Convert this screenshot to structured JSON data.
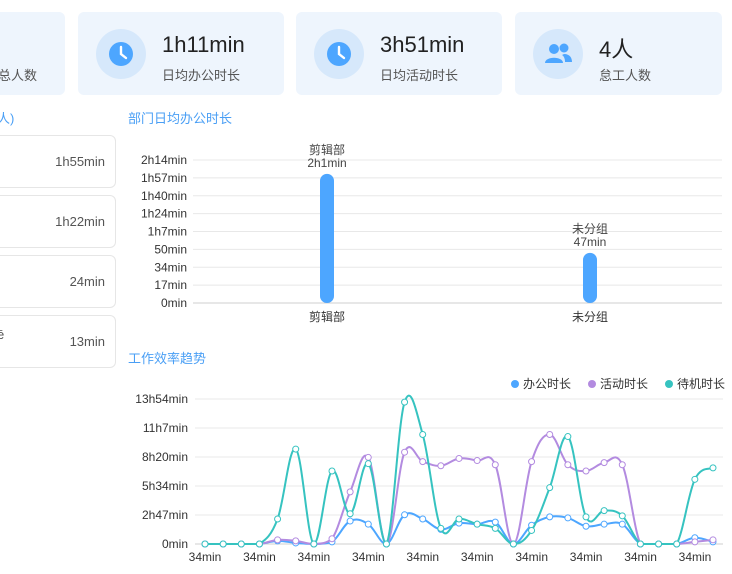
{
  "stats": [
    {
      "value": "",
      "label": "总人数",
      "icon": "people-icon"
    },
    {
      "value": "1h11min",
      "label": "日均办公时长",
      "icon": "clock-icon"
    },
    {
      "value": "3h51min",
      "label": "日均活动时长",
      "icon": "clock-icon"
    },
    {
      "value": "4人",
      "label": "怠工人数",
      "icon": "people-icon"
    }
  ],
  "ranking": {
    "title_fragment": "人)",
    "items": [
      {
        "name": "",
        "value": "1h55min"
      },
      {
        "name": "",
        "value": "1h22min"
      },
      {
        "name": "",
        "value": "24min"
      },
      {
        "name": "ē",
        "value": "13min"
      }
    ]
  },
  "dept_chart": {
    "title": "部门日均办公时长",
    "chart_data": {
      "type": "bar",
      "categories": [
        "剪辑部",
        "未分组"
      ],
      "values": [
        121,
        47
      ],
      "data_labels_name": [
        "剪辑部",
        "未分组"
      ],
      "data_labels_value": [
        "2h1min",
        "47min"
      ],
      "yticks": [
        "0min",
        "17min",
        "34min",
        "50min",
        "1h7min",
        "1h24min",
        "1h40min",
        "1h57min",
        "2h14min"
      ],
      "ylim": [
        0,
        134
      ],
      "color": "#4da6ff"
    }
  },
  "trend_chart": {
    "title": "工作效率趋势",
    "chart_data": {
      "type": "line",
      "series": [
        {
          "name": "办公时长",
          "color": "#4da6ff",
          "values": [
            0,
            0,
            0,
            0,
            0.3,
            0.1,
            0,
            0.2,
            2.2,
            1.9,
            0,
            2.8,
            2.4,
            1.4,
            2.0,
            1.9,
            2.1,
            0,
            1.8,
            2.6,
            2.5,
            1.7,
            1.9,
            1.9,
            0,
            0,
            0,
            0.6,
            0.2
          ]
        },
        {
          "name": "活动时长",
          "color": "#b38be0",
          "values": [
            0,
            0,
            0,
            0,
            0.4,
            0.3,
            0,
            0.5,
            5.0,
            8.3,
            0,
            8.8,
            7.9,
            7.5,
            8.2,
            8.0,
            7.6,
            0,
            7.9,
            10.5,
            7.6,
            7.0,
            7.8,
            7.6,
            0,
            0,
            0,
            0.2,
            0.4
          ]
        },
        {
          "name": "待机时长",
          "color": "#36c3c0",
          "values": [
            0,
            0,
            0,
            0,
            2.4,
            9.1,
            0,
            7.0,
            2.9,
            7.7,
            0,
            13.6,
            10.5,
            1.5,
            2.4,
            1.9,
            1.5,
            0,
            1.3,
            5.4,
            10.3,
            2.6,
            3.2,
            2.7,
            0,
            0,
            0,
            6.2,
            7.3
          ]
        }
      ],
      "yticks": [
        "0min",
        "2h47min",
        "5h34min",
        "8h20min",
        "11h7min",
        "13h54min"
      ],
      "ylim": [
        0,
        13.9
      ],
      "xtick_label": "34min",
      "xtick_count": 10
    }
  }
}
